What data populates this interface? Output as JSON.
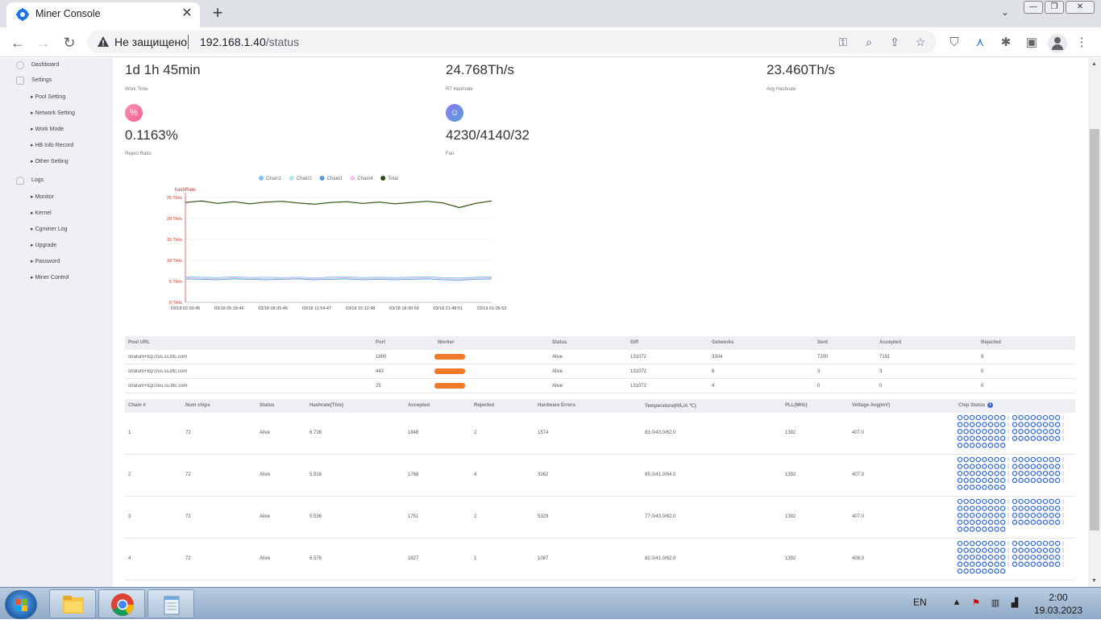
{
  "browser": {
    "tab_title": "Miner Console",
    "tab_close": "✕",
    "new_tab": "+",
    "insecure_label": "Не защищено",
    "url_host": "192.168.1.40",
    "url_path": "/status"
  },
  "sidebar": {
    "top": [
      {
        "label": "Dashboard"
      },
      {
        "label": "Settings"
      }
    ],
    "settings_items": [
      {
        "label": "▸ Pool Setting"
      },
      {
        "label": "▸ Network Setting"
      },
      {
        "label": "▸ Work Mode"
      },
      {
        "label": "▸ HB Info Record"
      },
      {
        "label": "▸ Other Setting"
      }
    ],
    "logs_label": "Logs",
    "logs_items": [
      {
        "label": "▸ Monitor"
      },
      {
        "label": "▸ Kernel"
      },
      {
        "label": "▸ Cgminer Log"
      },
      {
        "label": "▸ Upgrade"
      },
      {
        "label": "▸ Password"
      },
      {
        "label": "▸ Miner Control"
      }
    ]
  },
  "stats": {
    "work_time_value": "1d 1h 45min",
    "work_time_label": "Work Time",
    "rt_hashrate_value": "24.768Th/s",
    "rt_hashrate_label": "RT Hashrate",
    "avg_hashrate_value": "23.460Th/s",
    "avg_hashrate_label": "Avg Hashrate",
    "reject_value": "0.1163%",
    "reject_label": "Reject Ratio",
    "reject_icon": "%",
    "fan_value": "4230/4140/32",
    "fan_label": "Fan"
  },
  "colors": {
    "accent_pink": "#f06292",
    "accent_purple": "#7c6cf0",
    "chain1": "#7cc3f0",
    "chain2": "#b8e2f2",
    "chain3": "#5b9bd5",
    "chain4": "#f3c5ec",
    "total": "#2b4d11",
    "axis_red": "#c0392b",
    "chip_blue": "#3a6fd8",
    "worker_mask": "#f07a2a"
  },
  "chart_data": {
    "type": "line",
    "title": "",
    "ylabel": "hashRate",
    "xlabel": "",
    "ylim": [
      0,
      25
    ],
    "y_ticks": [
      "0 TH/s",
      "5 TH/s",
      "10 TH/s",
      "15 TH/s",
      "20 TH/s",
      "25 TH/s"
    ],
    "x_ticks": [
      "03/18 02:00:45",
      "03/18 05:18:46",
      "03/18 08:35:46",
      "03/18 11:54:47",
      "03/18 15:12:48",
      "03/18 18:30:50",
      "03/18 21:48:51",
      "03/19 01:06:53"
    ],
    "legend": [
      "Chain1",
      "Chain2",
      "Chain3",
      "Chain4",
      "Total"
    ],
    "legend_position": "top",
    "series": [
      {
        "name": "Total",
        "values": [
          23.8,
          24.2,
          23.6,
          24.0,
          23.5,
          23.9,
          24.1,
          23.7,
          23.4,
          23.8,
          24.0,
          23.6,
          23.9,
          23.5,
          23.8,
          24.1,
          23.7,
          22.6,
          23.6,
          24.2
        ]
      },
      {
        "name": "Chain1",
        "values": [
          6.1,
          6.0,
          5.9,
          6.1,
          5.9,
          6.0,
          5.9,
          6.0,
          5.8,
          6.0,
          6.1,
          5.9,
          6.0,
          5.9,
          6.0,
          6.1,
          5.9,
          5.8,
          6.0,
          6.1
        ]
      },
      {
        "name": "Chain2",
        "values": [
          5.8,
          5.7,
          5.6,
          5.8,
          5.7,
          5.6,
          5.7,
          5.8,
          5.6,
          5.7,
          5.8,
          5.6,
          5.7,
          5.6,
          5.7,
          5.8,
          5.6,
          5.5,
          5.7,
          5.8
        ]
      },
      {
        "name": "Chain3",
        "values": [
          5.6,
          5.5,
          5.4,
          5.6,
          5.5,
          5.4,
          5.5,
          5.6,
          5.4,
          5.5,
          5.6,
          5.4,
          5.5,
          5.4,
          5.5,
          5.6,
          5.4,
          5.3,
          5.5,
          5.6
        ]
      },
      {
        "name": "Chain4",
        "values": [
          5.9,
          5.8,
          5.7,
          5.9,
          5.8,
          5.7,
          5.8,
          5.9,
          5.7,
          5.8,
          5.9,
          5.7,
          5.8,
          5.7,
          5.8,
          5.9,
          5.7,
          5.6,
          5.8,
          5.9
        ]
      }
    ]
  },
  "pool_table": {
    "headers": [
      "Pool URL",
      "Port",
      "Worker",
      "Status",
      "Diff",
      "Getworks",
      "Sent",
      "Accepted",
      "Rejected"
    ],
    "rows": [
      [
        "stratum+tcp://us.ss.btc.com",
        "1800",
        "",
        "Alive",
        "131072",
        "3304",
        "7200",
        "7191",
        "9"
      ],
      [
        "stratum+tcp://us.ss.btc.com",
        "443",
        "",
        "Alive",
        "131072",
        "8",
        "3",
        "3",
        "0"
      ],
      [
        "stratum+tcp://eu.ss.btc.com",
        "25",
        "",
        "Alive",
        "131072",
        "4",
        "0",
        "0",
        "0"
      ]
    ]
  },
  "chain_table": {
    "headers": [
      "Chain #",
      "Num chips",
      "Status",
      "Hashrate(Th/s)",
      "Accepted",
      "Rejected",
      "Hardware Errors",
      "Temperature(H/L/A ℃)",
      "PLL(MHz)",
      "Voltage Avg(mV)",
      "Chip Status"
    ],
    "chip_status_info_icon": "i",
    "rows": [
      [
        "1",
        "72",
        "Alive",
        "6.738",
        "1848",
        "2",
        "1574",
        "83.0/43.0/62.0",
        "1392",
        "407.0"
      ],
      [
        "2",
        "72",
        "Alive",
        "5.916",
        "1768",
        "4",
        "3262",
        "85.0/41.0/64.0",
        "1392",
        "407.0"
      ],
      [
        "3",
        "72",
        "Alive",
        "5.536",
        "1751",
        "2",
        "5329",
        "77.0/43.0/62.0",
        "1392",
        "407.0"
      ],
      [
        "4",
        "72",
        "Alive",
        "6.576",
        "1827",
        "1",
        "1087",
        "82.0/41.0/62.0",
        "1392",
        "408.0"
      ]
    ]
  },
  "taskbar": {
    "lang": "EN",
    "time": "2:00",
    "date": "19.03.2023"
  }
}
